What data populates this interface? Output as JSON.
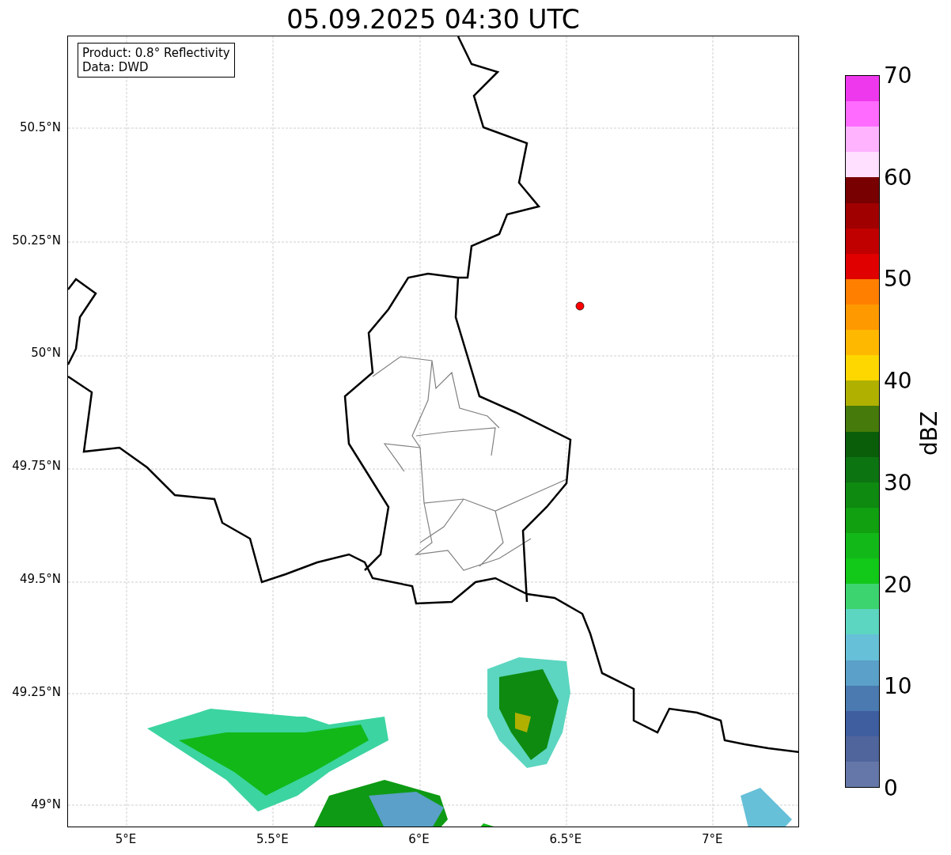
{
  "title": "05.09.2025 04:30 UTC",
  "map": {
    "info": [
      "Product: 0.8° Reflectivity",
      "Data: DWD"
    ],
    "y_ticks": [
      "50.5°N",
      "50.25°N",
      "50°N",
      "49.75°N",
      "49.5°N",
      "49.25°N",
      "49°N"
    ],
    "x_ticks": [
      "5°E",
      "5.5°E",
      "6°E",
      "6.5°E",
      "7°E"
    ]
  },
  "colorbar": {
    "label": "dBZ",
    "ticks": [
      "70",
      "60",
      "50",
      "40",
      "30",
      "20",
      "10",
      "0"
    ],
    "bands": [
      {
        "color": "#ee38ee"
      },
      {
        "color": "#ff6bff"
      },
      {
        "color": "#ffb3ff"
      },
      {
        "color": "#ffe0ff"
      },
      {
        "color": "#780000"
      },
      {
        "color": "#a00000"
      },
      {
        "color": "#c00000"
      },
      {
        "color": "#e00000"
      },
      {
        "color": "#ff7f00"
      },
      {
        "color": "#ff9900"
      },
      {
        "color": "#ffb800"
      },
      {
        "color": "#ffd700"
      },
      {
        "color": "#b0b000"
      },
      {
        "color": "#467a0a"
      },
      {
        "color": "#0a5e0a"
      },
      {
        "color": "#0c7410"
      },
      {
        "color": "#0e8a10"
      },
      {
        "color": "#10a010"
      },
      {
        "color": "#12b818"
      },
      {
        "color": "#12c818"
      },
      {
        "color": "#3cd46e"
      },
      {
        "color": "#5cd6c0"
      },
      {
        "color": "#66c0d8"
      },
      {
        "color": "#5aa0c8"
      },
      {
        "color": "#4a7ab0"
      },
      {
        "color": "#3f5ea0"
      },
      {
        "color": "#50659c"
      },
      {
        "color": "#6577a8"
      }
    ]
  }
}
